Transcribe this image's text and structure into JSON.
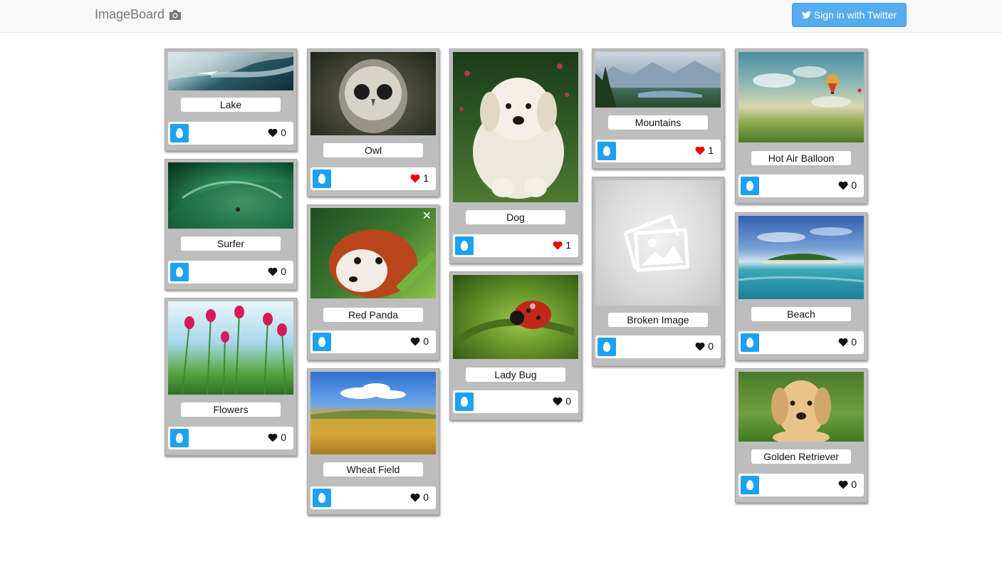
{
  "navbar": {
    "brand": "ImageBoard",
    "brand_icon": "camera-icon",
    "signin_label": "Sign in with Twitter",
    "signin_icon": "twitter-icon",
    "signin_color": "#55acee"
  },
  "colors": {
    "liked": "#ee0000",
    "unliked": "#111111",
    "avatar": "#1da1f2"
  },
  "cards": [
    {
      "title": "Lake",
      "likes": "0",
      "liked": false
    },
    {
      "title": "Surfer",
      "likes": "0",
      "liked": false
    },
    {
      "title": "Flowers",
      "likes": "0",
      "liked": false
    },
    {
      "title": "Owl",
      "likes": "1",
      "liked": true
    },
    {
      "title": "Red Panda",
      "likes": "0",
      "liked": false
    },
    {
      "title": "Wheat Field",
      "likes": "0",
      "liked": false
    },
    {
      "title": "Dog",
      "likes": "1",
      "liked": true
    },
    {
      "title": "Lady Bug",
      "likes": "0",
      "liked": false
    },
    {
      "title": "Mountains",
      "likes": "1",
      "liked": true
    },
    {
      "title": "Broken Image",
      "likes": "0",
      "liked": false
    },
    {
      "title": "Hot Air Balloon",
      "likes": "0",
      "liked": false
    },
    {
      "title": "Beach",
      "likes": "0",
      "liked": false
    },
    {
      "title": "Golden Retriever",
      "likes": "0",
      "liked": false
    }
  ]
}
